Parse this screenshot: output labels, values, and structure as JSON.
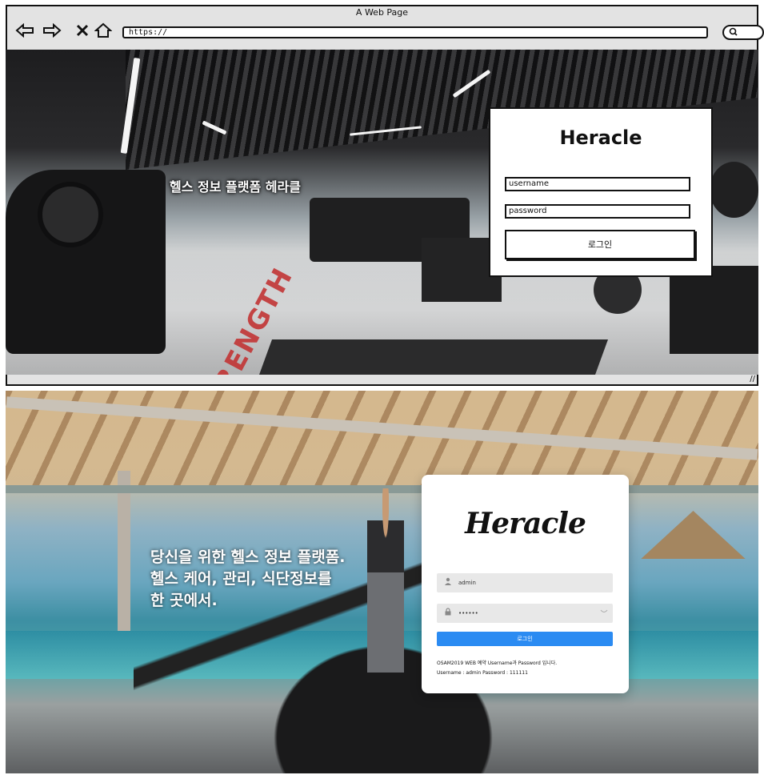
{
  "browser": {
    "title": "A Web Page",
    "url": "https://",
    "nav_icons": [
      "back-arrow-icon",
      "forward-arrow-icon",
      "close-icon",
      "home-icon"
    ],
    "search_icon": "search-icon"
  },
  "wireframe": {
    "slogan": "헬스 정보 플랫폼 헤라클",
    "login": {
      "title": "Heracle",
      "username_placeholder": "username",
      "password_placeholder": "password",
      "button": "로그인"
    },
    "floor_text": "STRENGTH"
  },
  "design": {
    "slogan_lines": [
      "당신을 위한 헬스 정보 플랫폼.",
      "헬스 케어, 관리, 식단정보를",
      "한 곳에서."
    ],
    "login": {
      "logo": "Heracle",
      "username_value": "admin",
      "password_value": "••••••",
      "button": "로그인",
      "note1": "OSAM2019 WEB 예약 Username과 Password 입니다.",
      "note2": "Username : admin     Password : 111111"
    },
    "colors": {
      "button": "#2b8bf2",
      "field_bg": "#e8e8e8"
    }
  }
}
